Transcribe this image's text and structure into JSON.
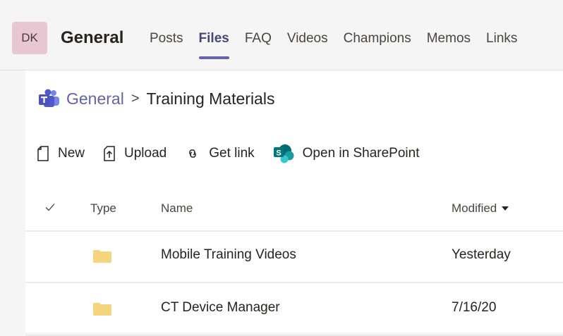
{
  "header": {
    "avatar_initials": "DK",
    "channel_title": "General",
    "tabs": [
      {
        "label": "Posts",
        "active": false
      },
      {
        "label": "Files",
        "active": true
      },
      {
        "label": "FAQ",
        "active": false
      },
      {
        "label": "Videos",
        "active": false
      },
      {
        "label": "Champions",
        "active": false
      },
      {
        "label": "Memos",
        "active": false
      },
      {
        "label": "Links",
        "active": false
      }
    ]
  },
  "breadcrumb": {
    "root": "General",
    "separator": ">",
    "current": "Training Materials"
  },
  "toolbar": {
    "new_label": "New",
    "upload_label": "Upload",
    "get_link_label": "Get link",
    "sharepoint_label": "Open in SharePoint"
  },
  "table": {
    "columns": {
      "type": "Type",
      "name": "Name",
      "modified": "Modified"
    },
    "rows": [
      {
        "type_icon": "folder-icon",
        "name": "Mobile Training Videos",
        "modified": "Yesterday"
      },
      {
        "type_icon": "folder-icon",
        "name": "CT Device Manager",
        "modified": "7/16/20"
      }
    ]
  },
  "colors": {
    "accent": "#6264a7",
    "avatar_bg": "#e8c6d2",
    "folder": "#f4d47c",
    "sharepoint": "#038387"
  }
}
